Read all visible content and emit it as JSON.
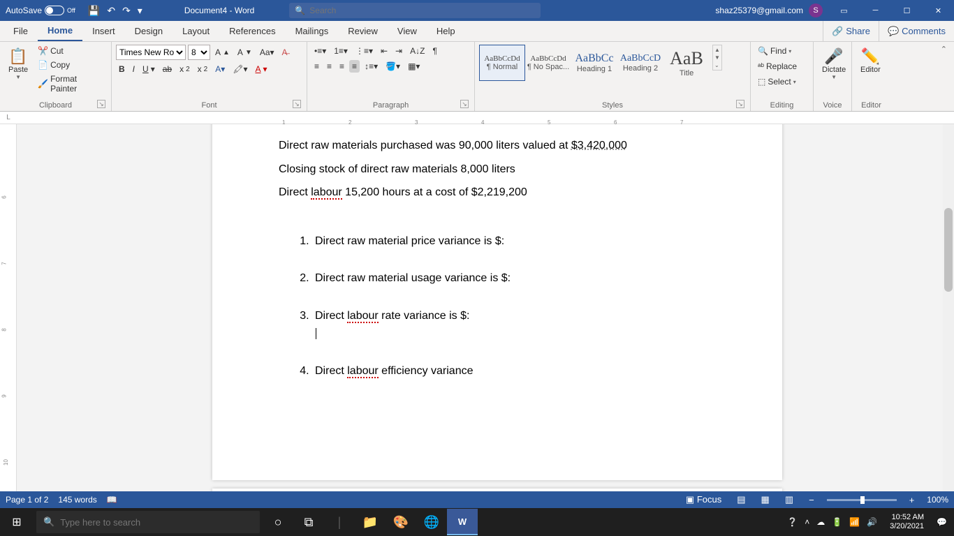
{
  "titlebar": {
    "autosave_label": "AutoSave",
    "autosave_state": "Off",
    "doc_title": "Document4 - Word",
    "search_placeholder": "Search",
    "user_email": "shaz25379@gmail.com",
    "avatar_initial": "S"
  },
  "tabs": {
    "items": [
      "File",
      "Home",
      "Insert",
      "Design",
      "Layout",
      "References",
      "Mailings",
      "Review",
      "View",
      "Help"
    ],
    "active_index": 1,
    "share": "Share",
    "comments": "Comments"
  },
  "ribbon": {
    "clipboard": {
      "paste": "Paste",
      "cut": "Cut",
      "copy": "Copy",
      "format_painter": "Format Painter",
      "label": "Clipboard"
    },
    "font": {
      "font_name": "Times New Rom",
      "font_size": "8",
      "label": "Font"
    },
    "paragraph": {
      "label": "Paragraph"
    },
    "styles": {
      "items": [
        {
          "preview": "AaBbCcDd",
          "name": "¶ Normal"
        },
        {
          "preview": "AaBbCcDd",
          "name": "¶ No Spac..."
        },
        {
          "preview": "AaBbCc",
          "name": "Heading 1"
        },
        {
          "preview": "AaBbCcD",
          "name": "Heading 2"
        },
        {
          "preview": "AaB",
          "name": "Title"
        }
      ],
      "label": "Styles"
    },
    "editing": {
      "find": "Find",
      "replace": "Replace",
      "select": "Select",
      "label": "Editing"
    },
    "voice": {
      "dictate": "Dictate",
      "label": "Voice"
    },
    "editor": {
      "editor": "Editor",
      "label": "Editor"
    }
  },
  "document": {
    "p1": "Direct raw materials purchased was 90,000 liters valued at ",
    "p1_u": "$3,420,000",
    "p2": "Closing stock of direct raw materials 8,000 liters",
    "p3a": "Direct ",
    "p3b": "labour",
    "p3c": " 15,200 hours at a cost of $2,219,200",
    "li1": "Direct raw material price variance is $:",
    "li2": "Direct raw material usage variance is $:",
    "li3a": "Direct ",
    "li3b": "labour",
    "li3c": " rate variance is $:",
    "li4a": "Direct ",
    "li4b": "labour",
    "li4c": " efficiency variance"
  },
  "statusbar": {
    "page": "Page 1 of 2",
    "words": "145 words",
    "focus": "Focus",
    "zoom": "100%"
  },
  "taskbar": {
    "search_placeholder": "Type here to search",
    "time": "10:52 AM",
    "date": "3/20/2021"
  }
}
